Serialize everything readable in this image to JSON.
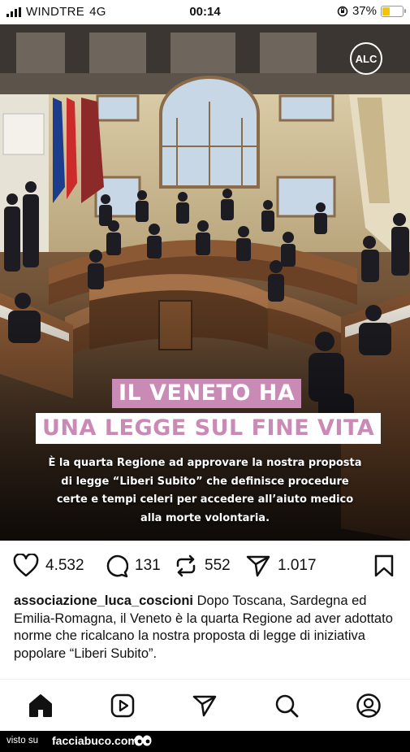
{
  "status_bar": {
    "carrier": "WINDTRE",
    "network": "4G",
    "time": "00:14",
    "battery_percent": "37%",
    "battery_level": 0.37
  },
  "post": {
    "logo_text": "ALC",
    "headline_line1": "IL VENETO HA",
    "headline_line2": "UNA LEGGE SUL FINE VITA",
    "subtitle_lines": [
      "È la quarta Regione ad approvare la nostra proposta",
      "di legge “Liberi Subito” che definisce procedure",
      "certe e tempi celeri per accedere all’aiuto medico",
      "alla morte volontaria."
    ],
    "colors": {
      "accent_pink": "#c98bb5"
    }
  },
  "actions": {
    "likes": "4.532",
    "comments": "131",
    "reposts": "552",
    "shares": "1.017"
  },
  "caption": {
    "username": "associazione_luca_coscioni",
    "text": " Dopo Toscana, Sardegna ed Emilia-Romagna,  il Veneto è la quarta Regione ad aver adottato norme che ricalcano la nostra proposta di legge di iniziativa popolare “Liberi Subito”."
  },
  "bottom_nav": {
    "items": [
      "home-icon",
      "reels-icon",
      "direct-icon",
      "search-icon",
      "profile-icon"
    ]
  },
  "watermark": {
    "prefix": "visto su",
    "brand": "facciabuco.com"
  }
}
